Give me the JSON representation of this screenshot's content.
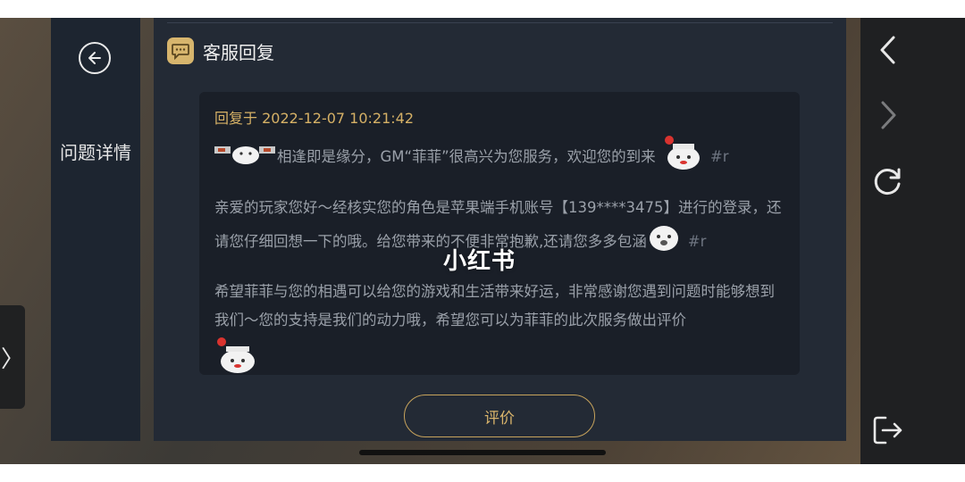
{
  "side_nav": {
    "title": "问题详情"
  },
  "panel": {
    "title": "客服回复"
  },
  "reply": {
    "time": "回复于 2022-12-07 10:21:42",
    "paragraph1": "相逢即是缘分，GM“菲菲”很高兴为您服务，欢迎您的到来",
    "paragraph1_tag": "#r",
    "paragraph2": "亲爱的玩家您好～经核实您的角色是苹果端手机账号【139****3475】进行的登录，还请您仔细回想一下的哦。给您带来的不便非常抱歉,还请您多多包涵",
    "paragraph2_tag": "#r",
    "paragraph3": "希望菲菲与您的相遇可以给您的游戏和生活带来好运，非常感谢您遇到问题时能够想到我们～您的支持是我们的动力哦，希望您可以为菲菲的此次服务做出评价"
  },
  "rate_button": {
    "label": "评价"
  },
  "watermark": "小红书",
  "left_tab": {
    "glyph": "〉"
  },
  "colors": {
    "accent": "#d6b166",
    "panel": "#232a35",
    "card": "#1a1f28",
    "nav": "#1d2530"
  },
  "icons": [
    "back-circle-icon",
    "chat-bubble-icon",
    "chevron-left-icon",
    "chevron-right-icon",
    "refresh-icon",
    "exit-icon",
    "sticker-icon"
  ]
}
